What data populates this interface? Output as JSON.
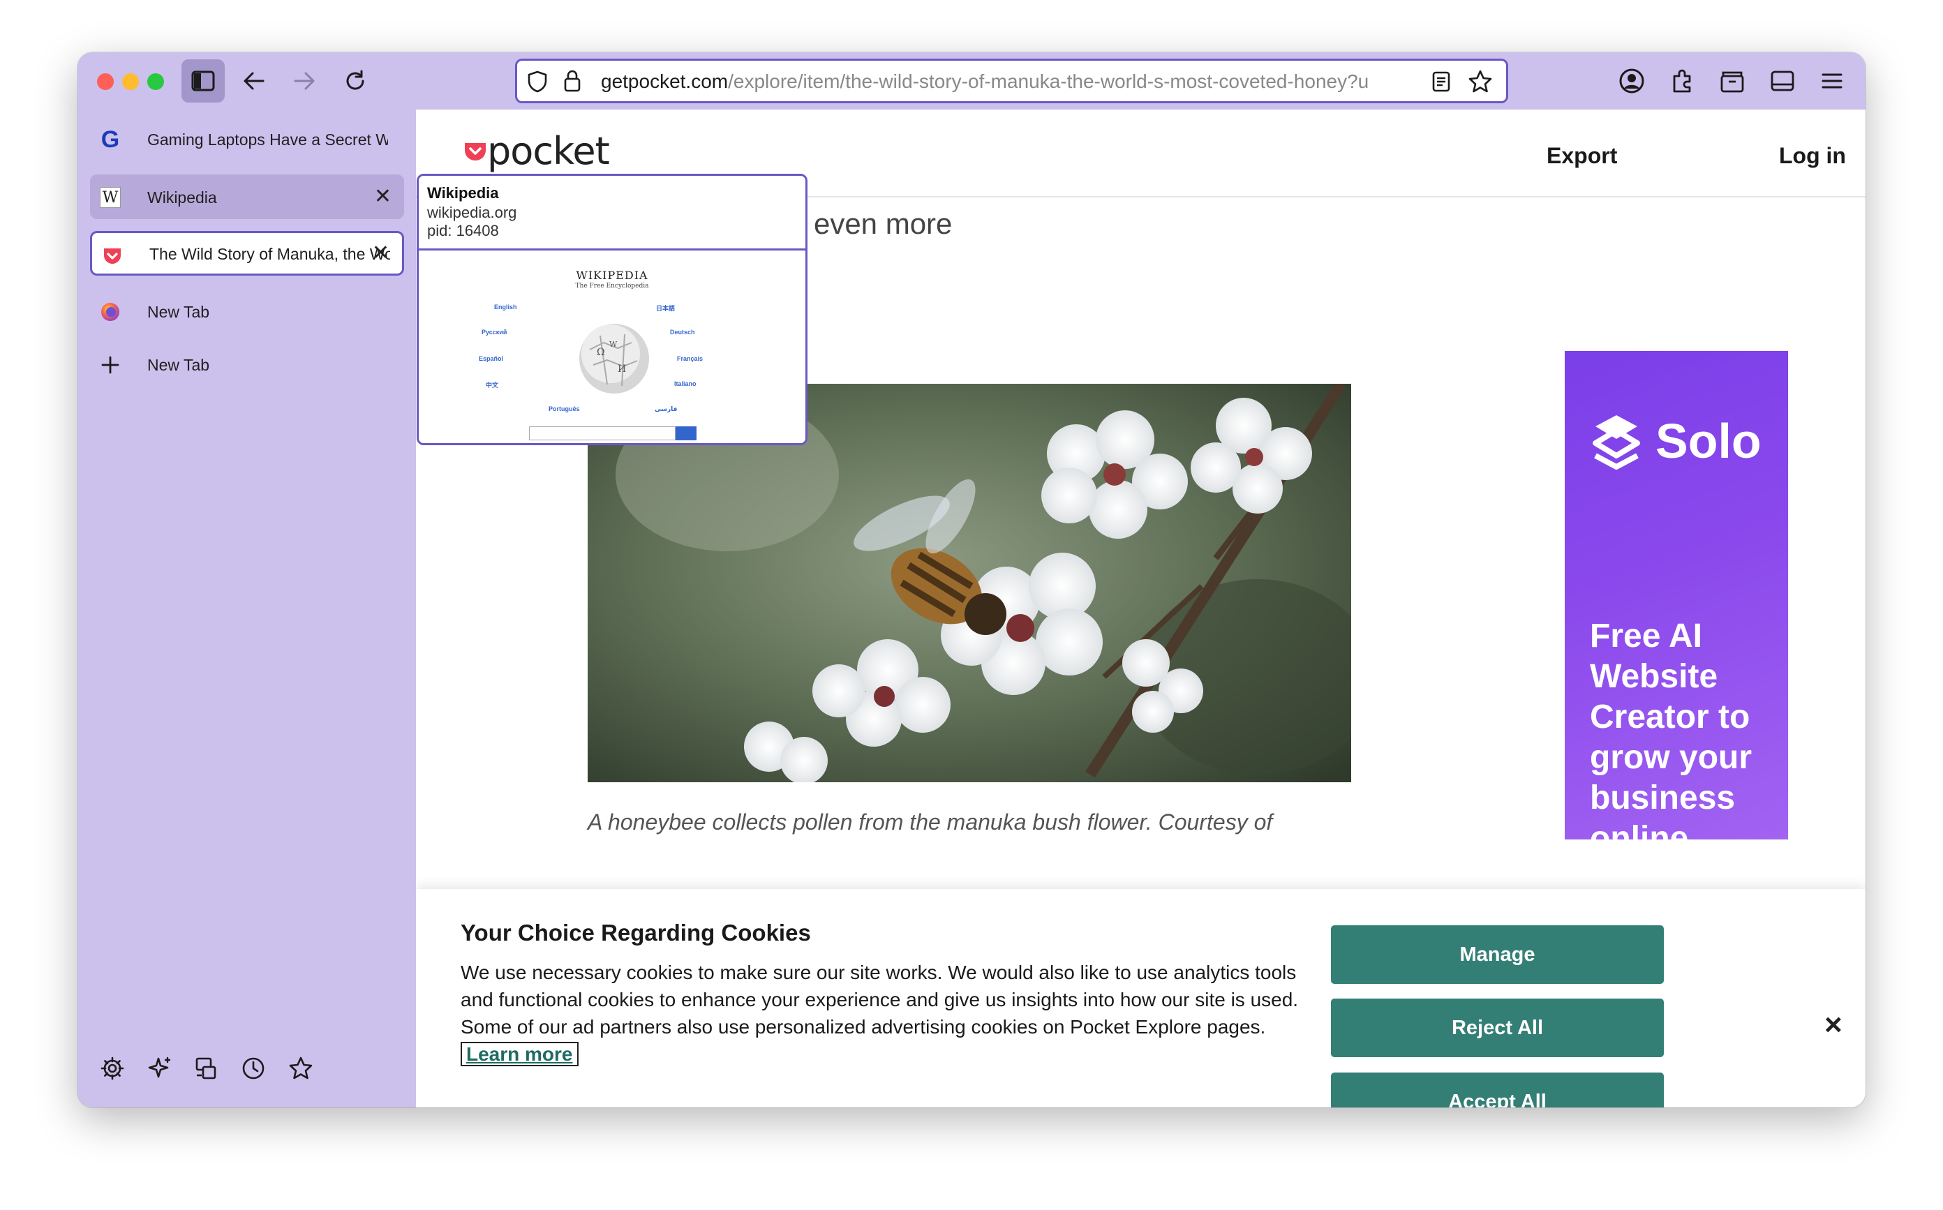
{
  "browser": {
    "url_host": "getpocket.com",
    "url_path": "/explore/item/the-wild-story-of-manuka-the-world-s-most-coveted-honey?u",
    "colors": {
      "frame": "#ccc1ec",
      "accent": "#6a58c4"
    }
  },
  "sidebar": {
    "tabs": [
      {
        "label": "Gaming Laptops Have a Secret Weapon",
        "icon": "g-icon"
      },
      {
        "label": "Wikipedia",
        "icon": "wikipedia-icon"
      },
      {
        "label": "The Wild Story of Manuka, the World's Most Coveted Honey",
        "icon": "pocket-icon"
      },
      {
        "label": "New Tab",
        "icon": "firefox-icon"
      },
      {
        "label": "New Tab",
        "icon": "plus-icon"
      }
    ]
  },
  "tab_preview": {
    "title": "Wikipedia",
    "host": "wikipedia.org",
    "pid": "pid: 16408",
    "thumb_logo": "WIKIPEDIA",
    "thumb_tagline": "The Free Encyclopedia",
    "thumb_languages": [
      "English",
      "日本語",
      "Русский",
      "Deutsch",
      "Español",
      "Français",
      "中文",
      "Italiano",
      "Português",
      "فارسی"
    ]
  },
  "site": {
    "logo_text": "pocket",
    "nav": {
      "export": "Export",
      "login": "Log in"
    },
    "article_fragment": "s the unusual history of an even more",
    "caption": "A honeybee collects pollen from the manuka bush flower. Courtesy of"
  },
  "ad": {
    "brand": "Solo",
    "copy": "Free AI Website Creator to grow your business online"
  },
  "cookie": {
    "title": "Your Choice Regarding Cookies",
    "body": "We use necessary cookies to make sure our site works. We would also like to use analytics tools and functional cookies to enhance your experience and give us insights into how our site is used. Some of our ad partners also use personalized advertising cookies on Pocket Explore pages.",
    "learn_more": "Learn more",
    "manage": "Manage",
    "reject": "Reject All",
    "accept": "Accept All",
    "close": "×",
    "button_color": "#337f75"
  }
}
